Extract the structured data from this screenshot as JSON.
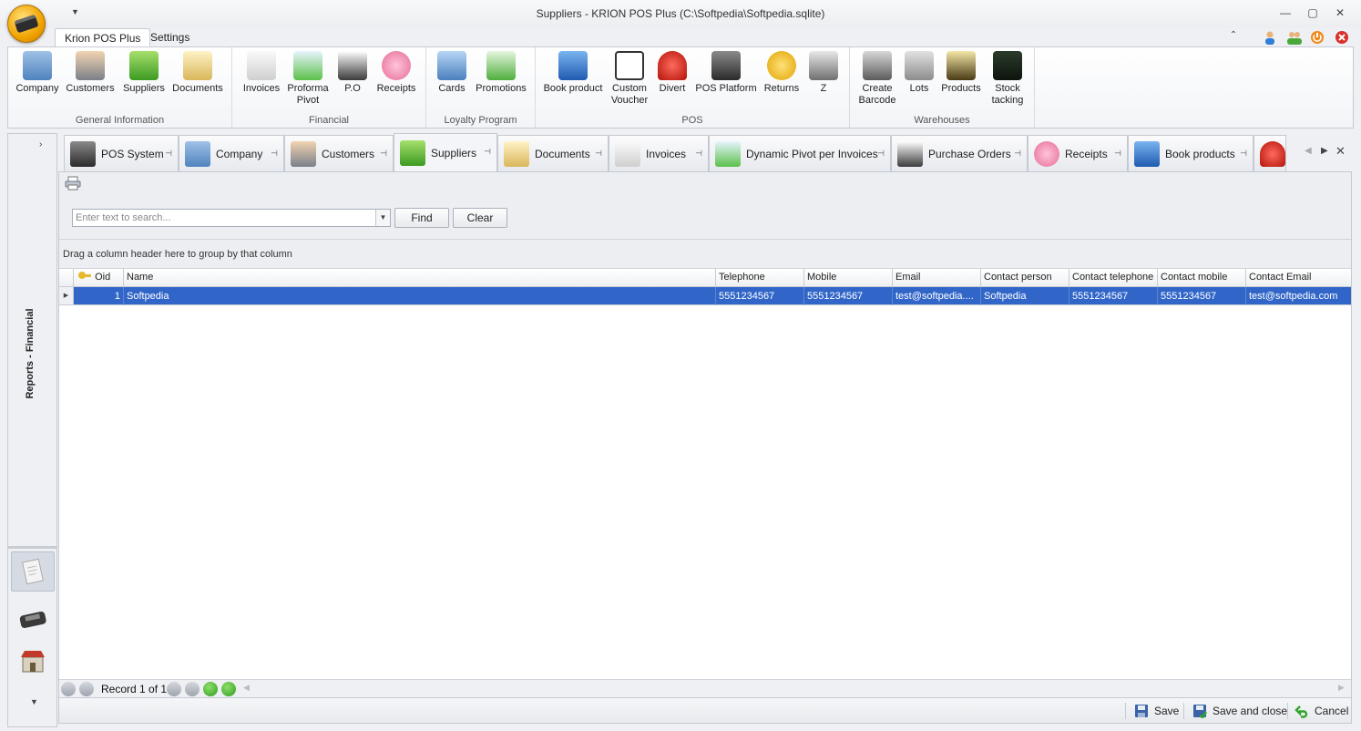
{
  "window": {
    "title": "Suppliers - KRION POS Plus (C:\\Softpedia\\Softpedia.sqlite)"
  },
  "ribbon_tabs": [
    "Krion POS Plus",
    "Settings"
  ],
  "ribbon": {
    "groups": [
      {
        "label": "General Information",
        "buttons": [
          "Company",
          "Customers",
          "Suppliers",
          "Documents"
        ]
      },
      {
        "label": "Financial",
        "buttons": [
          "Invoices",
          "Proforma Pivot",
          "P.O",
          "Receipts"
        ]
      },
      {
        "label": "Loyalty Program",
        "buttons": [
          "Cards",
          "Promotions"
        ]
      },
      {
        "label": "POS",
        "buttons": [
          "Book product",
          "Custom Voucher",
          "Divert",
          "POS Platform",
          "Returns",
          "Z"
        ]
      },
      {
        "label": "Warehouses",
        "buttons": [
          "Create Barcode",
          "Lots",
          "Products",
          "Stock tacking"
        ]
      }
    ]
  },
  "leftnav": {
    "section_label": "Reports - Financial"
  },
  "doc_tabs": [
    "POS System",
    "Company",
    "Customers",
    "Suppliers",
    "Documents",
    "Invoices",
    "Dynamic Pivot per Invoices",
    "Purchase Orders",
    "Receipts",
    "Book products"
  ],
  "toolbar": {
    "search_placeholder": "Enter text to search...",
    "find_label": "Find",
    "clear_label": "Clear"
  },
  "group_panel_text": "Drag a column header here to group by that column",
  "grid": {
    "columns": [
      "Oid",
      "Name",
      "Telephone",
      "Mobile",
      "Email",
      "Contact person",
      "Contact telephone",
      "Contact mobile",
      "Contact Email"
    ],
    "rows": [
      [
        "1",
        "Softpedia",
        "5551234567",
        "5551234567",
        "test@softpedia....",
        "Softpedia",
        "5551234567",
        "5551234567",
        "test@softpedia.com"
      ]
    ]
  },
  "navigator": {
    "record_text": "Record 1 of 1"
  },
  "bottom": {
    "save_label": "Save",
    "save_close_label": "Save and close",
    "cancel_label": "Cancel"
  },
  "colors": {
    "selection": "#3166c8",
    "orb": "#f0a300"
  }
}
